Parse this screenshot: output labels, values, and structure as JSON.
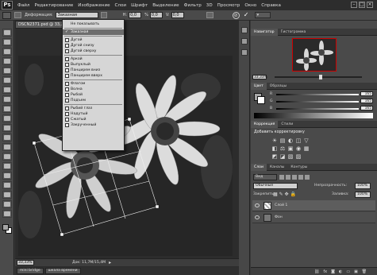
{
  "app": {
    "logo": "Ps"
  },
  "menu": [
    "Файл",
    "Редактирование",
    "Изображение",
    "Слои",
    "Шрифт",
    "Выделение",
    "Фильтр",
    "3D",
    "Просмотр",
    "Окно",
    "Справка"
  ],
  "window_controls": [
    "–",
    "□",
    "×"
  ],
  "options_bar": {
    "warp_label": "Деформация:",
    "warp_value": "Заказная",
    "h_label": "Н:",
    "h_value": "0,0",
    "v_label": "%",
    "v_value": "0,0",
    "v2_label": "V:",
    "v2_value": "0,0"
  },
  "document": {
    "tab_title": "DSCN2371.psd @ 33,...",
    "zoom": "33,33%",
    "status": "Док: 11,7М/15,4М"
  },
  "bottom_tabs": [
    "mini bridge",
    "шкала времени"
  ],
  "warp_dropdown": {
    "items": [
      {
        "label": "Не показывать",
        "type": "item"
      },
      {
        "type": "sep"
      },
      {
        "label": "Заказная",
        "type": "item",
        "checked": true,
        "selected": true
      },
      {
        "type": "sep"
      },
      {
        "label": "Дугой",
        "type": "item"
      },
      {
        "label": "Дугой снизу",
        "type": "item"
      },
      {
        "label": "Дугой сверху",
        "type": "item"
      },
      {
        "type": "sep"
      },
      {
        "label": "Аркой",
        "type": "item"
      },
      {
        "label": "Выпуклый",
        "type": "item"
      },
      {
        "label": "Панцирем вниз",
        "type": "item"
      },
      {
        "label": "Панцирем вверх",
        "type": "item"
      },
      {
        "type": "sep"
      },
      {
        "label": "Флагом",
        "type": "item"
      },
      {
        "label": "Волна",
        "type": "item"
      },
      {
        "label": "Рыбой",
        "type": "item"
      },
      {
        "label": "Подъем",
        "type": "item"
      },
      {
        "type": "sep"
      },
      {
        "label": "Рыбий глаз",
        "type": "item"
      },
      {
        "label": "Надутый",
        "type": "item"
      },
      {
        "label": "Сжатый",
        "type": "item"
      },
      {
        "label": "Закрученный",
        "type": "item"
      }
    ]
  },
  "navigator": {
    "tabs": [
      "Навигатор",
      "Гистограмма"
    ],
    "zoom": "33,33%"
  },
  "color": {
    "tabs": [
      "Цвет",
      "Образцы"
    ],
    "channels": [
      {
        "label": "R",
        "value": "165"
      },
      {
        "label": "G",
        "value": "165"
      },
      {
        "label": "B",
        "value": "165"
      }
    ]
  },
  "adjustments": {
    "tabs": [
      "Коррекция",
      "Стили"
    ],
    "title": "Добавить корректировку",
    "row1": [
      "☀",
      "▤",
      "◐",
      "◫",
      "▽"
    ],
    "row2": [
      "◧",
      "⚖",
      "▣",
      "◉",
      "▦"
    ],
    "row3": [
      "◩",
      "◪",
      "▧",
      "▨"
    ]
  },
  "layers": {
    "tabs": [
      "Слои",
      "Каналы",
      "Контуры"
    ],
    "kind_label": "Вид",
    "blend_mode": "Обычные",
    "opacity_label": "Непрозрачность:",
    "opacity_value": "100%",
    "lock_label": "Закрепить:",
    "fill_label": "Заливка:",
    "fill_value": "100%",
    "items": [
      {
        "name": "Слой 1"
      },
      {
        "name": "Фон"
      }
    ]
  },
  "colors": {
    "menubar": "#2d2d2d",
    "panel": "#4a4a4a",
    "dropdown_bg": "#d6d6d6",
    "highlight": "#6d6d6d"
  }
}
